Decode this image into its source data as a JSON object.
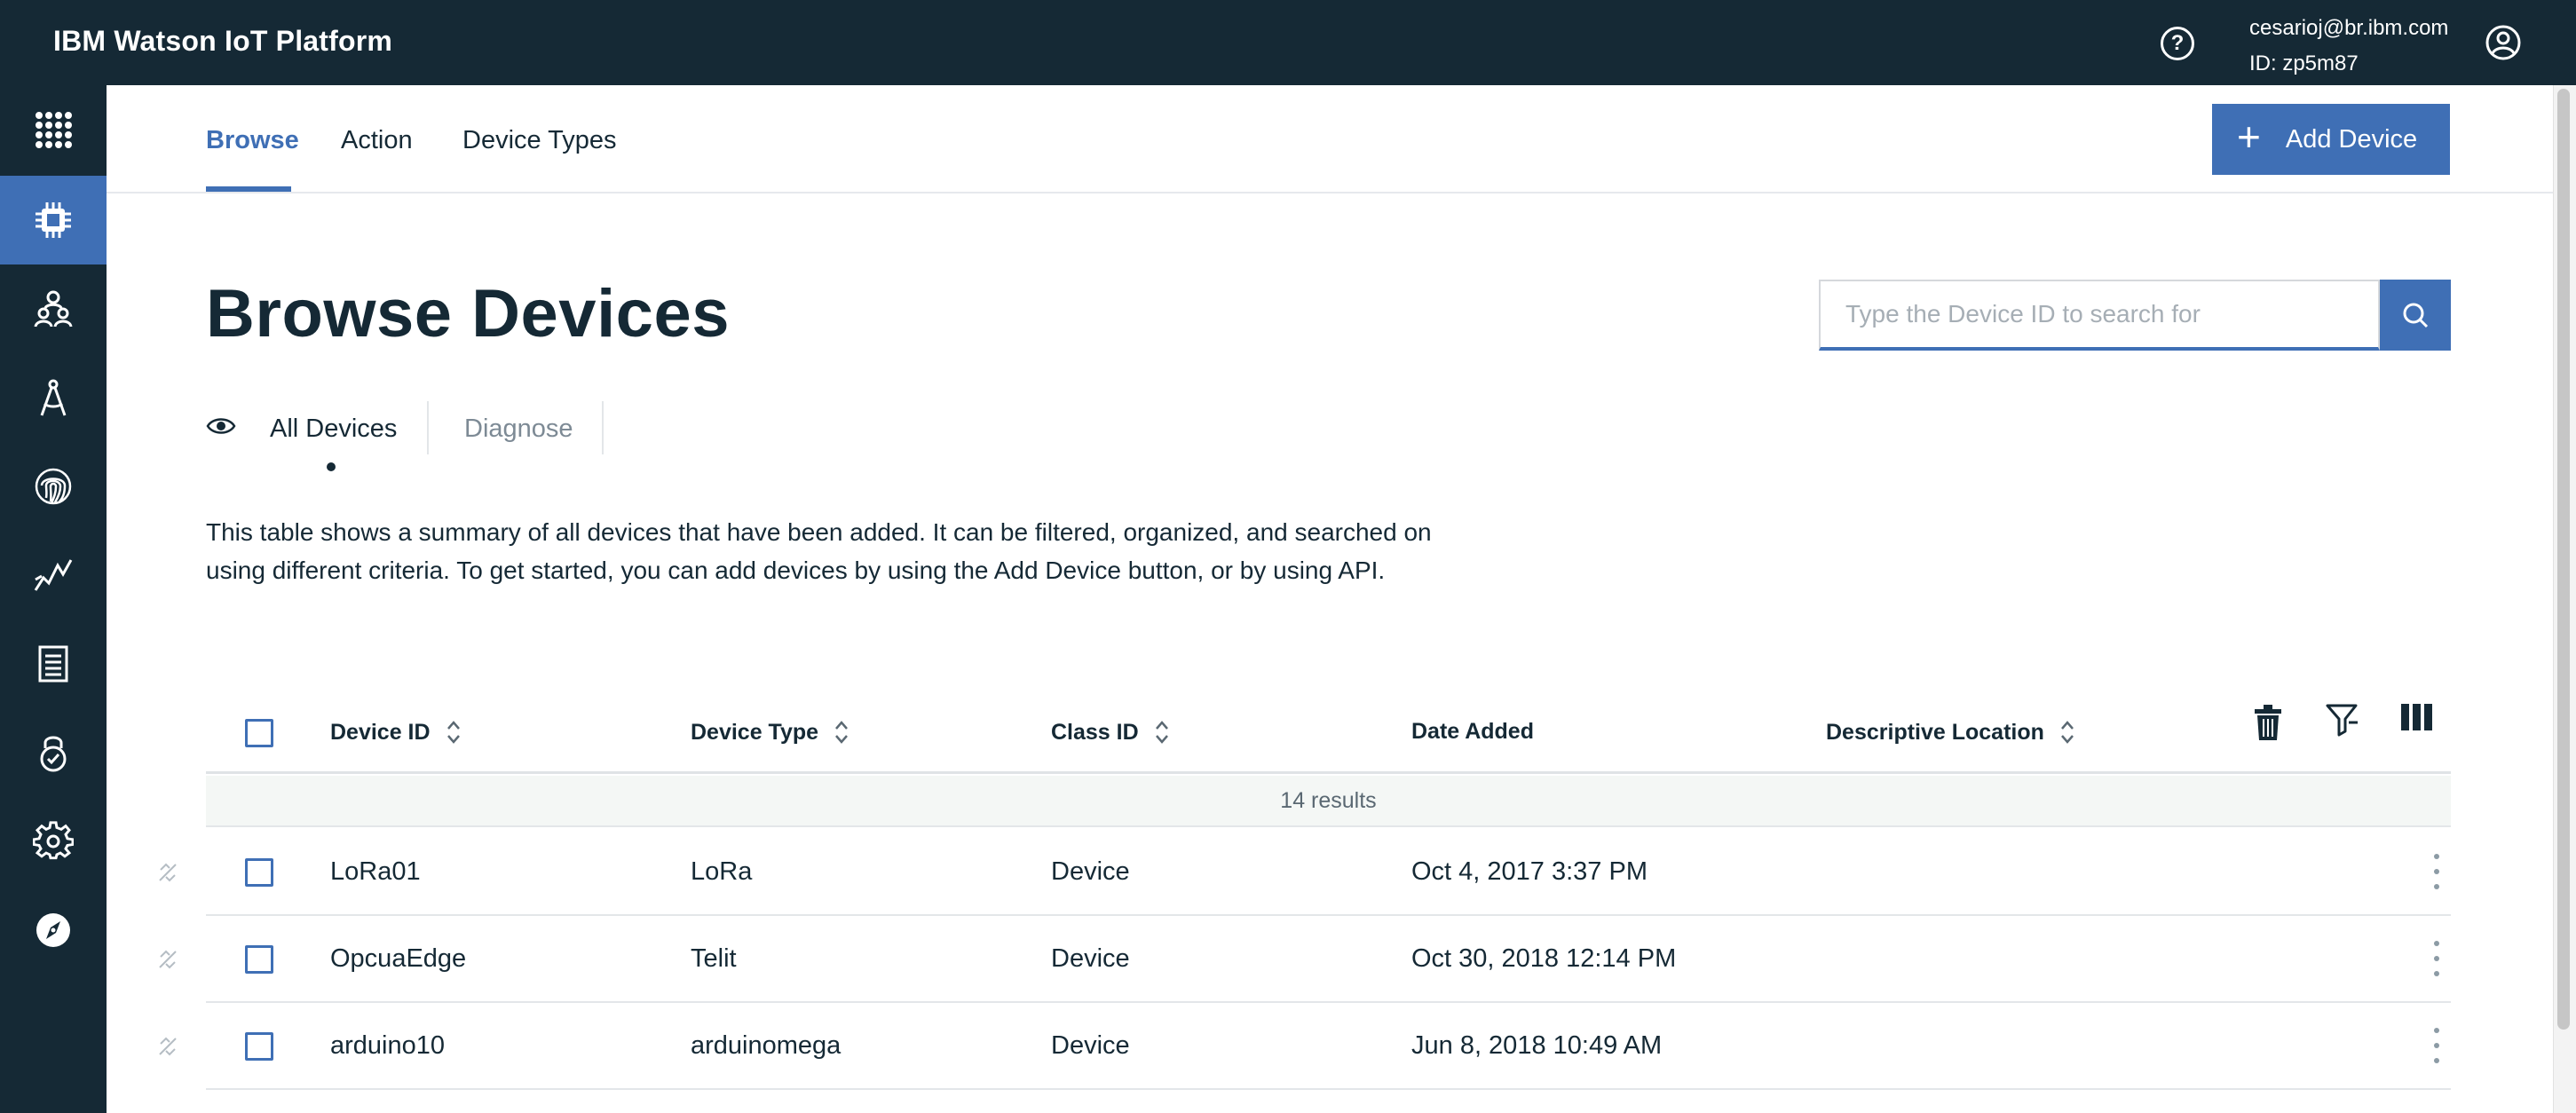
{
  "app": {
    "title": "IBM Watson IoT Platform",
    "user_email": "cesarioj@br.ibm.com",
    "user_id": "ID: zp5m87"
  },
  "sidebar": {
    "items": [
      {
        "icon": "app-switcher-icon",
        "active": false
      },
      {
        "icon": "devices-chip-icon",
        "active": true
      },
      {
        "icon": "members-icon",
        "active": false
      },
      {
        "icon": "apps-compass-icon",
        "active": false
      },
      {
        "icon": "fingerprint-icon",
        "active": false
      },
      {
        "icon": "analytics-chart-icon",
        "active": false
      },
      {
        "icon": "usage-document-icon",
        "active": false
      },
      {
        "icon": "security-lock-icon",
        "active": false
      },
      {
        "icon": "settings-gear-icon",
        "active": false
      },
      {
        "icon": "explore-compass-icon",
        "active": false
      }
    ]
  },
  "nav": {
    "tabs": [
      {
        "label": "Browse",
        "active": true
      },
      {
        "label": "Action",
        "active": false
      },
      {
        "label": "Device Types",
        "active": false
      }
    ],
    "add_device_label": "Add Device"
  },
  "page": {
    "title": "Browse Devices",
    "search_placeholder": "Type the Device ID to search for",
    "view_tabs": [
      {
        "label": "All Devices",
        "active": true
      },
      {
        "label": "Diagnose",
        "active": false
      }
    ],
    "description": "This table shows a summary of all devices that have been added. It can be filtered, organized, and searched on using different criteria. To get started, you can add devices by using the Add Device button, or by using API."
  },
  "table": {
    "columns": [
      "Device ID",
      "Device Type",
      "Class ID",
      "Date Added",
      "Descriptive Location"
    ],
    "results_label": "14 results",
    "rows": [
      {
        "device_id": "LoRa01",
        "device_type": "LoRa",
        "class_id": "Device",
        "date_added": "Oct 4, 2017 3:37 PM",
        "location": ""
      },
      {
        "device_id": "OpcuaEdge",
        "device_type": "Telit",
        "class_id": "Device",
        "date_added": "Oct 30, 2018 12:14 PM",
        "location": ""
      },
      {
        "device_id": "arduino10",
        "device_type": "arduinomega",
        "class_id": "Device",
        "date_added": "Jun 8, 2018 10:49 AM",
        "location": ""
      }
    ]
  },
  "colors": {
    "topbar": "#152935",
    "accent": "#3f6fb5"
  }
}
